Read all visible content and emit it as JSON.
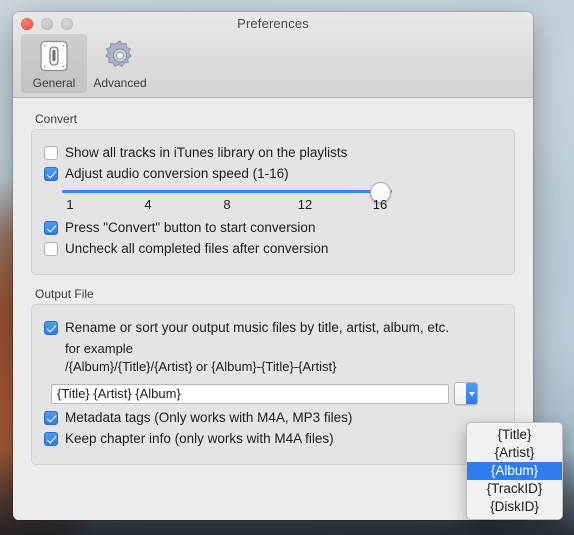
{
  "window": {
    "title": "Preferences",
    "traffic_lights": [
      "close-button",
      "minimize-button",
      "maximize-button"
    ]
  },
  "toolbar": {
    "items": [
      {
        "label": "General",
        "icon": "device-switch-icon",
        "selected": true
      },
      {
        "label": "Advanced",
        "icon": "gear-icon",
        "selected": false
      }
    ]
  },
  "convert": {
    "group_label": "Convert",
    "show_all_tracks": {
      "label": "Show all tracks in iTunes library on the playlists",
      "checked": false
    },
    "adjust_speed": {
      "label": "Adjust audio conversion speed (1-16)",
      "checked": true
    },
    "slider": {
      "min": 1,
      "max": 16,
      "value": 16,
      "ticks": [
        "1",
        "4",
        "8",
        "12",
        "16"
      ]
    },
    "press_convert": {
      "label": "Press \"Convert\" button to start conversion",
      "checked": true
    },
    "uncheck_completed": {
      "label": "Uncheck all completed files after conversion",
      "checked": false
    }
  },
  "output_file": {
    "group_label": "Output File",
    "rename_sort": {
      "label": "Rename or sort your output music files by title, artist, album, etc.",
      "checked": true
    },
    "example_caption": "for example",
    "example_pattern": "/{Album}/{Title}/{Artist} or {Album}-{Title}-{Artist}",
    "pattern_input": {
      "value": "{Title} {Artist} {Album}",
      "placeholder": ""
    },
    "combo_button": {
      "icon": "chevron-down-icon"
    },
    "metadata_tags": {
      "label": "Metadata tags (Only works with M4A, MP3 files)",
      "checked": true
    },
    "keep_chapter_info": {
      "label": "Keep chapter info (only works with  M4A files)",
      "checked": true
    }
  },
  "dropdown": {
    "open": true,
    "items": [
      {
        "label": "{Title}",
        "highlighted": false
      },
      {
        "label": "{Artist}",
        "highlighted": false
      },
      {
        "label": "{Album}",
        "highlighted": true
      },
      {
        "label": "{TrackID}",
        "highlighted": false
      },
      {
        "label": "{DiskID}",
        "highlighted": false
      }
    ]
  },
  "colors": {
    "accent_blue": "#2f7ced",
    "slider_blue": "#3e86e8",
    "close_red": "#f04a3f",
    "window_bg": "#ececec",
    "group_bg": "#e4e4e4"
  }
}
